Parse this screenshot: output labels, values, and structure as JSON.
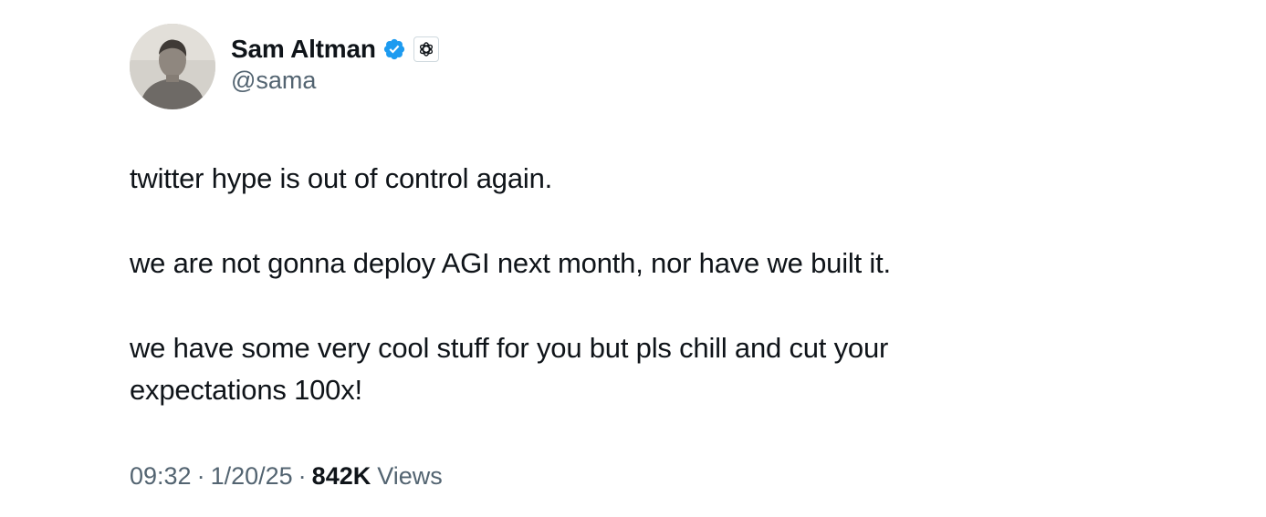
{
  "author": {
    "display_name": "Sam Altman",
    "handle": "@sama",
    "verified_icon": "verified-badge-icon",
    "affiliate_icon": "openai-logo-icon",
    "verified_color": "#1d9bf0"
  },
  "tweet": {
    "paragraphs": [
      "twitter hype is out of control again.",
      "we are not gonna deploy AGI next month, nor have we built it.",
      "we have some very cool stuff for you but pls chill and cut your expectations 100x!"
    ],
    "time": "09:32",
    "separator": "·",
    "date": "1/20/25",
    "views_count": "842K",
    "views_label": "Views"
  },
  "colors": {
    "text_primary": "#0f1419",
    "text_secondary": "#536471",
    "background": "#ffffff"
  }
}
